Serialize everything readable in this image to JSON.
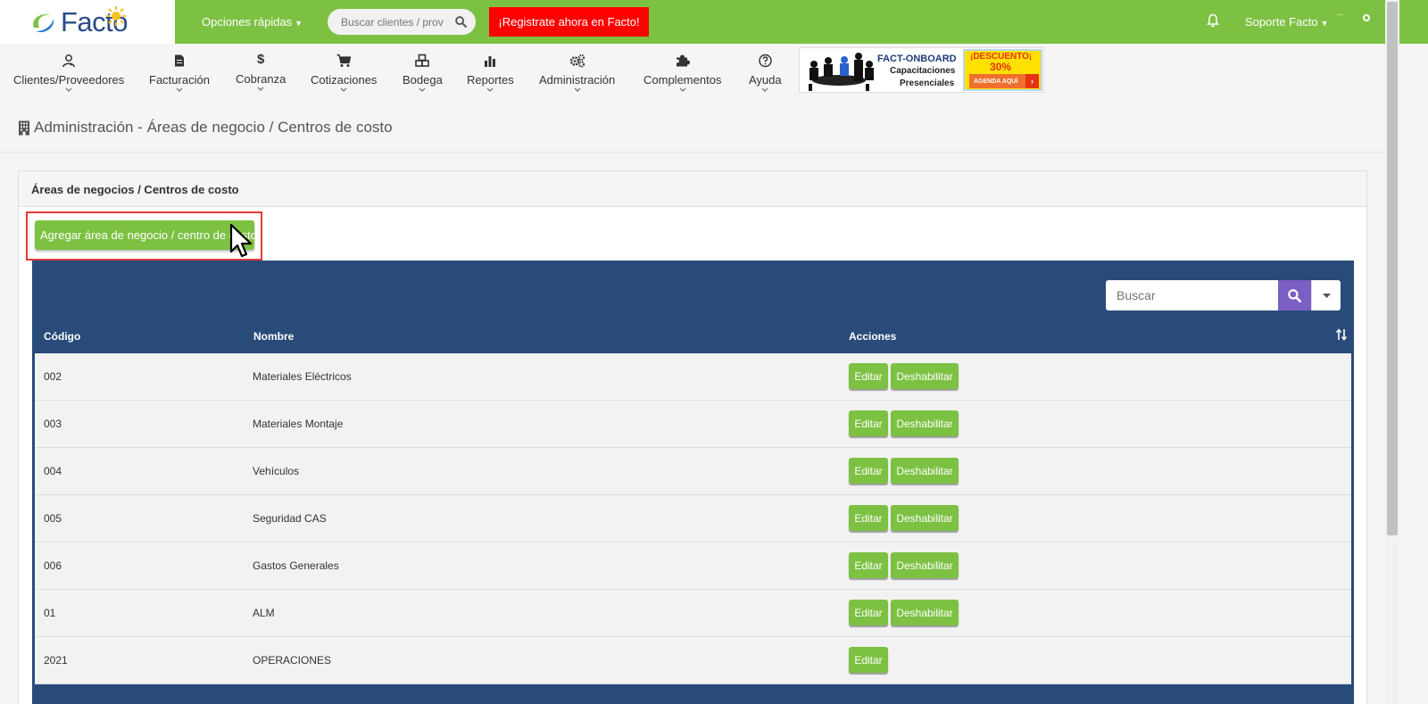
{
  "topbar": {
    "logo_text": "Facto",
    "quick_options": "Opciones rápidas",
    "search_placeholder": "Buscar clientes / prov",
    "register": "¡Registrate ahora en Facto!",
    "user_name": "Soporte Facto",
    "avatar_alt": "..."
  },
  "nav": {
    "items": [
      {
        "label": "Clientes/Proveedores",
        "icon": "user-group-icon"
      },
      {
        "label": "Facturación",
        "icon": "document-icon"
      },
      {
        "label": "Cobranza",
        "icon": "dollar-icon"
      },
      {
        "label": "Cotizaciones",
        "icon": "cart-icon"
      },
      {
        "label": "Bodega",
        "icon": "boxes-icon"
      },
      {
        "label": "Reportes",
        "icon": "bar-chart-icon"
      },
      {
        "label": "Administración",
        "icon": "gears-icon"
      },
      {
        "label": "Complementos",
        "icon": "puzzle-icon"
      },
      {
        "label": "Ayuda",
        "icon": "question-icon"
      }
    ],
    "banner": {
      "title": "FACT-ONBOARD",
      "line1": "Capacitaciones",
      "line2": "Presenciales",
      "promo_top": "¡DESCUENTO¡",
      "promo_pct": "30%",
      "promo_cta": "AGENDA AQUÍ",
      "promo_arrow": "›"
    }
  },
  "page": {
    "title": "Administración - Áreas de negocio / Centros de costo"
  },
  "panel": {
    "heading": "Áreas de negocios / Centros de costo",
    "add_button": "Agregar área de negocio / centro de costo"
  },
  "table": {
    "search_placeholder": "Buscar",
    "columns": [
      "Código",
      "Nombre",
      "Acciones"
    ],
    "edit_label": "Editar",
    "disable_label": "Deshabilitar",
    "rows": [
      {
        "code": "002",
        "name": "Materiales Eléctricos",
        "can_disable": true
      },
      {
        "code": "003",
        "name": "Materiales Montaje",
        "can_disable": true
      },
      {
        "code": "004",
        "name": "Vehículos",
        "can_disable": true
      },
      {
        "code": "005",
        "name": "Seguridad CAS",
        "can_disable": true
      },
      {
        "code": "006",
        "name": "Gastos Generales",
        "can_disable": true
      },
      {
        "code": "01",
        "name": "ALM",
        "can_disable": true
      },
      {
        "code": "2021",
        "name": "OPERACIONES",
        "can_disable": false
      }
    ]
  },
  "colors": {
    "brand_green": "#7dc143",
    "table_header": "#284b7a",
    "search_button": "#7b5fc4",
    "register_red": "#ff0000"
  }
}
